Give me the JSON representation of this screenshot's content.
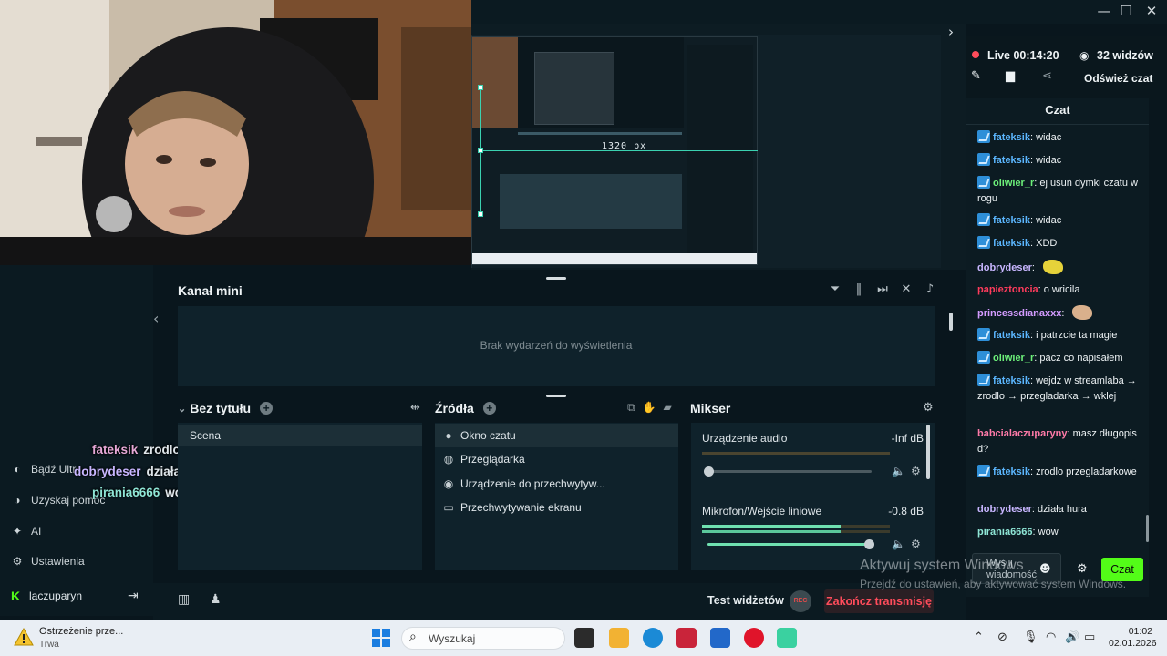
{
  "window": {
    "minimize": "—",
    "maximize": "☐",
    "close": "✕"
  },
  "preview": {
    "size_label": "1320 px"
  },
  "sidebar": {
    "items": [
      {
        "icon": "partner-icon",
        "label": "Bądź Ultr"
      },
      {
        "icon": "help-icon",
        "label": "Uzyskaj pomoc"
      },
      {
        "icon": "ai-sparkle-icon",
        "label": "AI"
      },
      {
        "icon": "gear-icon",
        "label": "Ustawienia"
      }
    ],
    "user": "laczuparyn"
  },
  "overlay_chat": [
    {
      "user": "fateksik",
      "text": "zrodlo przegladarkowe",
      "color": "#e6a8d7"
    },
    {
      "user": "dobrydeser",
      "text": "działa hura",
      "color": "#c8b6ff"
    },
    {
      "user": "pirania6666",
      "text": "wow",
      "color": "#8fe6d6"
    }
  ],
  "mini_feed": {
    "title": "Kanał mini",
    "empty": "Brak wydarzeń do wyświetlenia"
  },
  "scenes": {
    "title": "Bez tytułu",
    "items": [
      "Scena"
    ]
  },
  "sources": {
    "title": "Źródła",
    "items": [
      {
        "icon": "chat-bubble-icon",
        "label": "Okno czatu"
      },
      {
        "icon": "globe-icon",
        "label": "Przeglądarka"
      },
      {
        "icon": "webcam-icon",
        "label": "Urządzenie do przechwytyw..."
      },
      {
        "icon": "monitor-icon",
        "label": "Przechwytywanie ekranu"
      }
    ]
  },
  "mixer": {
    "title": "Mikser",
    "channels": [
      {
        "name": "Urządzenie audio",
        "db": "-Inf dB",
        "level": 0.0
      },
      {
        "name": "Mikrofon/Wejście liniowe",
        "db": "-0.8 dB",
        "level": 0.98
      }
    ]
  },
  "bottom": {
    "test_widgets": "Test widżetów",
    "rec": "REC",
    "end_stream": "Zakończ transmisję"
  },
  "stream_status": {
    "live": "Live 00:14:20",
    "viewers": "32 widzów",
    "refresh": "Odśwież czat"
  },
  "chat": {
    "title": "Czat",
    "messages": [
      {
        "user": "fateksik",
        "text": "widac",
        "color": "#5cb7ff",
        "badge": true
      },
      {
        "user": "fateksik",
        "text": "widac",
        "color": "#5cb7ff",
        "badge": true
      },
      {
        "user": "oliwier_r",
        "text": "ej usuń dymki czatu w rogu",
        "color": "#6df07a",
        "badge": true
      },
      {
        "user": "fateksik",
        "text": "widac",
        "color": "#5cb7ff",
        "badge": true
      },
      {
        "user": "fateksik",
        "text": "XDD",
        "color": "#5cb7ff",
        "badge": true
      },
      {
        "user": "dobrydeser",
        "text": "",
        "color": "#c8b6ff",
        "badge": false,
        "emote": "#e6d23a"
      },
      {
        "user": "papieztoncia",
        "text": "o wricila",
        "color": "#ff3b5c",
        "badge": false
      },
      {
        "user": "princessdianaxxx",
        "text": "",
        "color": "#d49bff",
        "badge": false,
        "emote": "#d9b08c"
      },
      {
        "user": "fateksik",
        "text": "i patrzcie ta magie",
        "color": "#5cb7ff",
        "badge": true
      },
      {
        "user": "oliwier_r",
        "text": "pacz co napisałem",
        "color": "#6df07a",
        "badge": true
      },
      {
        "user": "fateksik",
        "text": "wejdz w streamlaba → zrodlo → przegladarka → wklej",
        "color": "#5cb7ff",
        "badge": true
      },
      {
        "user": "babcialaczuparyny",
        "text": "masz długopis d?",
        "color": "#ff7aa8",
        "badge": false
      },
      {
        "user": "fateksik",
        "text": "zrodlo przegladarkowe",
        "color": "#5cb7ff",
        "badge": true
      },
      {
        "user": "dobrydeser",
        "text": "działa hura",
        "color": "#c8b6ff",
        "badge": false
      },
      {
        "user": "pirania6666",
        "text": "wow",
        "color": "#8fe6d6",
        "badge": false
      }
    ],
    "input_placeholder": "Wyślij wiadomość",
    "send": "Czat"
  },
  "watermark": {
    "line1": "Aktywuj system Windows",
    "line2": "Przejdź do ustawień, aby aktywować system Windows."
  },
  "taskbar": {
    "warning_title": "Ostrzeżenie prze...",
    "warning_sub": "Trwa",
    "search": "Wyszukaj",
    "time": "01:02",
    "date": "02.01.2026"
  }
}
